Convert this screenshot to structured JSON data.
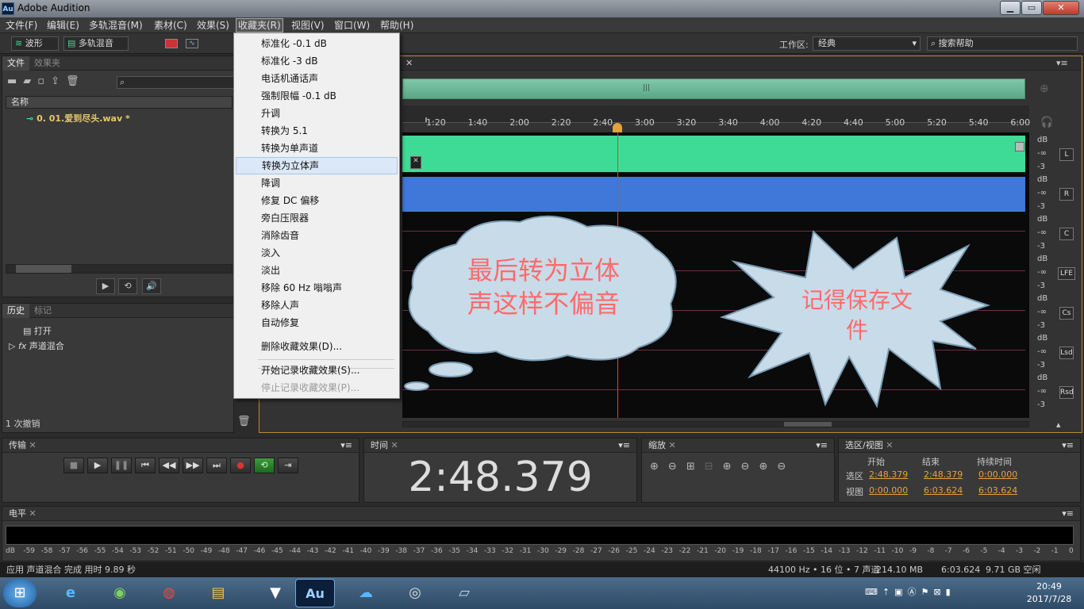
{
  "app": {
    "title": "Adobe Audition",
    "logo": "Au"
  },
  "menubar": [
    "文件(F)",
    "编辑(E)",
    "多轨混音(M)",
    "素材(C)",
    "效果(S)",
    "收藏夹(R)",
    "视图(V)",
    "窗口(W)",
    "帮助(H)"
  ],
  "toolbar": {
    "waveform": "波形",
    "multitrack": "多轨混音",
    "workspace_label": "工作区:",
    "workspace_value": "经典",
    "search_placeholder": "搜索帮助"
  },
  "favorites_menu": {
    "items": [
      "标准化 -0.1 dB",
      "标准化 -3 dB",
      "电话机通话声",
      "强制限幅 -0.1 dB",
      "升调",
      "转换为 5.1",
      "转换为单声道",
      "转换为立体声",
      "降调",
      "修复 DC 偏移",
      "旁白压限器",
      "消除齿音",
      "淡入",
      "淡出",
      "移除 60 Hz 嗡嗡声",
      "移除人声",
      "自动修复"
    ],
    "highlighted_index": 7,
    "delete": "删除收藏效果(D)...",
    "start_record": "开始记录收藏效果(S)...",
    "stop_record": "停止记录收藏效果(P)..."
  },
  "files_panel": {
    "tab_files": "文件",
    "tab_effects": "效果夹",
    "col_name": "名称",
    "file": "0. 01.爱到尽头.wav *"
  },
  "history_panel": {
    "tab_history": "历史",
    "tab_marks": "标记",
    "items": [
      "打开",
      "声道混合"
    ],
    "undo": "1 次撤销"
  },
  "ruler_ticks": [
    "1:20",
    "1:40",
    "2:00",
    "2:20",
    "2:40",
    "3:00",
    "3:20",
    "3:40",
    "4:00",
    "4:20",
    "4:40",
    "5:00",
    "5:20",
    "5:40",
    "6:00"
  ],
  "channels": [
    "L",
    "R",
    "C",
    "LFE",
    "Cs",
    "Lsd",
    "Rsd"
  ],
  "db_labels": {
    "db": "dB",
    "inf": "-∞",
    "m3": "-3"
  },
  "annotations": {
    "cloud": "最后转为立体声这样不偏音",
    "cloud_line1": "最后转为立体",
    "cloud_line2": "声这样不偏音",
    "star_line1": "记得保存文",
    "star_line2": "件",
    "text_color": "#ff6b6b"
  },
  "transport": {
    "title": "传输"
  },
  "time_panel": {
    "title": "时间",
    "value": "2:48.379"
  },
  "zoom_panel": {
    "title": "缩放"
  },
  "selection_panel": {
    "title": "选区/视图",
    "col_start": "开始",
    "col_end": "结束",
    "col_dur": "持续时间",
    "sel_label": "选区",
    "view_label": "视图",
    "sel": [
      "2:48.379",
      "2:48.379",
      "0:00.000"
    ],
    "view": [
      "0:00.000",
      "6:03.624",
      "6:03.624"
    ]
  },
  "level_panel": {
    "title": "电平",
    "scale": [
      "dB",
      "-59",
      "-58",
      "-57",
      "-56",
      "-55",
      "-54",
      "-53",
      "-52",
      "-51",
      "-50",
      "-49",
      "-48",
      "-47",
      "-46",
      "-45",
      "-44",
      "-43",
      "-42",
      "-41",
      "-40",
      "-39",
      "-38",
      "-37",
      "-36",
      "-35",
      "-34",
      "-33",
      "-32",
      "-31",
      "-30",
      "-29",
      "-28",
      "-27",
      "-26",
      "-25",
      "-24",
      "-23",
      "-22",
      "-21",
      "-20",
      "-19",
      "-18",
      "-17",
      "-16",
      "-15",
      "-14",
      "-13",
      "-12",
      "-11",
      "-10",
      "-9",
      "-8",
      "-7",
      "-6",
      "-5",
      "-4",
      "-3",
      "-2",
      "-1",
      "0"
    ]
  },
  "status": {
    "left": "应用 声道混合 完成 用时 9.89 秒",
    "format": "44100 Hz • 16 位 • 7 声道",
    "size": "214.10 MB",
    "dur": "6:03.624",
    "free": "9.71 GB 空闲"
  },
  "clock": {
    "time": "20:49",
    "date": "2017/7/28"
  },
  "colors": {
    "wave_green": "#3ddb95",
    "wave_blue": "#3f78d8",
    "accent_orange": "#e6a23c"
  }
}
